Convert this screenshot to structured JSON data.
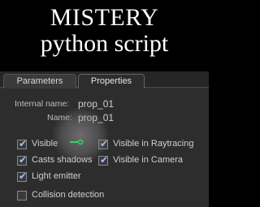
{
  "banner": {
    "title": "MISTERY",
    "subtitle": "python script"
  },
  "tabs": [
    {
      "label": "Parameters",
      "active": false
    },
    {
      "label": "Properties",
      "active": true
    }
  ],
  "fields": {
    "internal_name_label": "Internal name:",
    "internal_name_value": "prop_01",
    "name_label": "Name:",
    "name_value": "prop_01"
  },
  "checkboxes": {
    "visible": {
      "label": "Visible",
      "checked": true
    },
    "visible_in_raytracing": {
      "label": "Visible in Raytracing",
      "checked": true
    },
    "casts_shadows": {
      "label": "Casts shadows",
      "checked": true
    },
    "visible_in_camera": {
      "label": "Visible in Camera",
      "checked": true
    },
    "light_emitter": {
      "label": "Light emitter",
      "checked": true
    },
    "collision_detection": {
      "label": "Collision detection",
      "checked": false
    }
  },
  "colors": {
    "panel_bg": "#2d2d2d",
    "check": "#9fc4ff",
    "cursor": "#39d16a"
  },
  "icons": {
    "cursor": "pointer-cursor-icon",
    "check": "checkmark-icon"
  }
}
